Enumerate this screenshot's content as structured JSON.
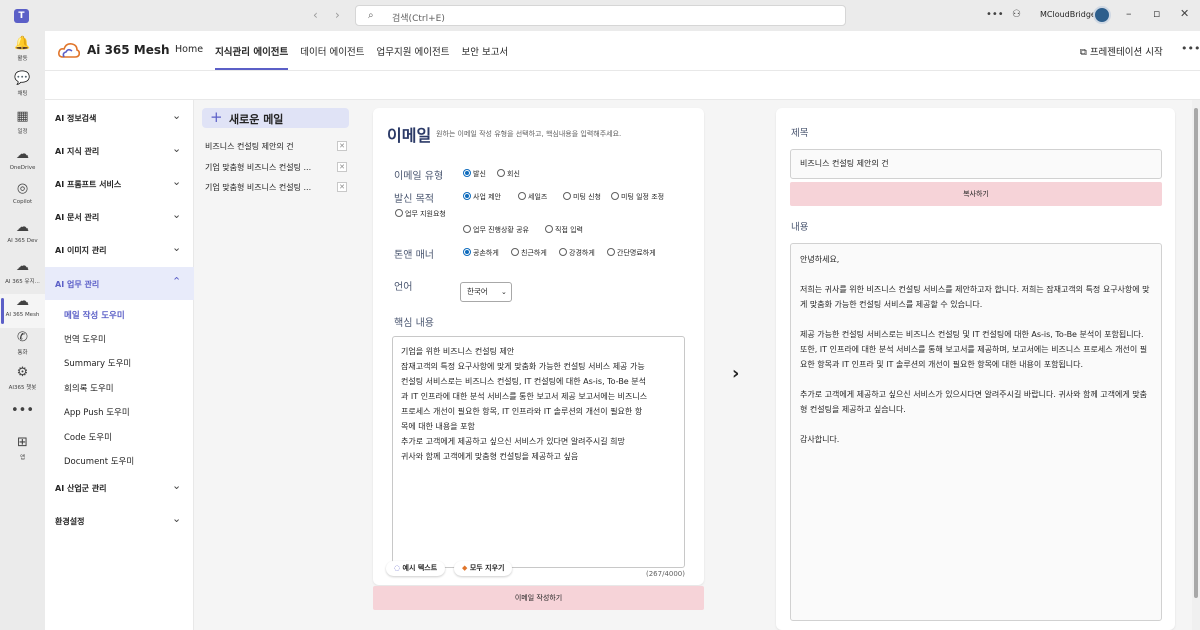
{
  "titlebar": {
    "search_placeholder": "검색(Ctrl+E)",
    "user_name": "MCloudBridge"
  },
  "rail": [
    {
      "icon": "bell-icon",
      "glyph": "🔔",
      "label": "활동"
    },
    {
      "icon": "chat-icon",
      "glyph": "💬",
      "label": "채팅"
    },
    {
      "icon": "calendar-icon",
      "glyph": "▦",
      "label": "일정"
    },
    {
      "icon": "cloud-icon",
      "glyph": "☁",
      "label": "OneDrive"
    },
    {
      "icon": "copilot-icon",
      "glyph": "◎",
      "label": "Copilot"
    },
    {
      "icon": "ai365-dev-icon",
      "glyph": "☁",
      "label": "AI 365 Dev"
    },
    {
      "icon": "ai365-yuji-icon",
      "glyph": "☁",
      "label": "AI 365 유지..."
    },
    {
      "icon": "ai365-mesh-icon",
      "glyph": "☁",
      "label": "AI 365 Mesh"
    },
    {
      "icon": "call-icon",
      "glyph": "✆",
      "label": "통화"
    },
    {
      "icon": "bot-icon",
      "glyph": "⚙",
      "label": "AI365 챗봇"
    },
    {
      "icon": "more-icon",
      "glyph": "•••",
      "label": ""
    },
    {
      "icon": "apps-icon",
      "glyph": "⊞",
      "label": "앱"
    }
  ],
  "app": {
    "name": "Ai 365 Mesh",
    "tabs": [
      "Home",
      "지식관리 에이전트",
      "데이터 에이전트",
      "업무지원 에이전트",
      "보안 보고서"
    ],
    "present_label": "프레젠테이션 시작"
  },
  "sidemenu": {
    "groups": [
      {
        "label": "AI 정보검색",
        "expanded": false
      },
      {
        "label": "AI 지식 관리",
        "expanded": false
      },
      {
        "label": "AI 프롬프트 서비스",
        "expanded": false
      },
      {
        "label": "AI 문서 관리",
        "expanded": false
      },
      {
        "label": "AI 이미지 관리",
        "expanded": false
      },
      {
        "label": "AI 업무 관리",
        "expanded": true
      }
    ],
    "sub_items": [
      "메일 작성 도우미",
      "번역 도우미",
      "Summary 도우미",
      "회의록 도우미",
      "App Push 도우미",
      "Code 도우미",
      "Document 도우미"
    ],
    "bottom_groups": [
      {
        "label": "AI 산업군 관리"
      },
      {
        "label": "환경설정"
      }
    ]
  },
  "history": {
    "new_label": "새로운 메일",
    "items": [
      "비즈니스 컨설팅 제안의 건",
      "기업 맞춤형 비즈니스 컨설팅 ...",
      "기업 맞춤형 비즈니스 컨설팅 ..."
    ]
  },
  "form": {
    "title": "이메일",
    "subtitle": "원하는 이메일 작성 유형을 선택하고, 핵심내용을 입력해주세요.",
    "type_label": "이메일 유형",
    "type_options": [
      "발신",
      "회신"
    ],
    "type_selected": 0,
    "purpose_label": "발신 목적",
    "purpose_options": [
      "사업 제안",
      "세일즈",
      "미팅 신청",
      "미팅 일정 조정",
      "업무 지원요청",
      "업무 진행상황 공유",
      "직접 입력"
    ],
    "purpose_selected": 0,
    "tone_label": "톤앤 매너",
    "tone_options": [
      "공손하게",
      "친근하게",
      "강경하게",
      "간단명료하게"
    ],
    "tone_selected": 0,
    "lang_label": "언어",
    "lang_value": "한국어",
    "core_label": "핵심 내용",
    "core_lines": [
      "기업을 위한 비즈니스 컨설팅 제안",
      "잠재고객의 특정 요구사항에 맞게 맞춤화 가능한 컨설팅 서비스 제공 가능",
      "컨설팅 서비스로는 비즈니스 컨설팅, IT 컨설팅에 대한 As-is, To-Be 분석",
      "과 IT 인프라에 대한 분석 서비스를 통한 보고서 제공 보고서에는 비즈니스",
      "프로세스 개선이 필요한 항목, IT 인프라와 IT 솔루션의 개선이 필요한 항",
      "목에 대한 내용을 포함",
      "추가로 고객에게 제공하고 싶으신 서비스가 있다면 알려주시길 희망",
      "귀사와 함께 고객에게 맞춤형 컨설팅을 제공하고 싶음"
    ],
    "example_btn": "예시 텍스트",
    "clear_btn": "모두 지우기",
    "counter": "(267/4000)",
    "generate_btn": "이메일 작성하기"
  },
  "result": {
    "subject_label": "제목",
    "subject_value": "비즈니스 컨설팅 제안의 건",
    "copy_btn": "복사하기",
    "body_label": "내용",
    "body_paragraphs": [
      "안녕하세요,",
      "저희는 귀사를 위한 비즈니스 컨설팅 서비스를 제안하고자 합니다. 저희는 잠재고객의 특정 요구사항에 맞게 맞춤화 가능한 컨설팅 서비스를 제공할 수 있습니다.",
      "제공 가능한 컨설팅 서비스로는 비즈니스 컨설팅 및 IT 컨설팅에 대한 As-is, To-Be 분석이 포함됩니다. 또한, IT 인프라에 대한 분석 서비스를 통해 보고서를 제공하며, 보고서에는 비즈니스 프로세스 개선이 필요한 항목과 IT 인프라 및 IT 솔루션의 개선이 필요한 항목에 대한 내용이 포함됩니다.",
      "추가로 고객에게 제공하고 싶으신 서비스가 있으시다면 알려주시길 바랍니다. 귀사와 함께 고객에게 맞춤형 컨설팅을 제공하고 싶습니다.",
      "감사합니다."
    ]
  },
  "colors": {
    "accent": "#5b5fc7",
    "button_pink": "#f6d3d8",
    "title_navy": "#2b3a67"
  }
}
